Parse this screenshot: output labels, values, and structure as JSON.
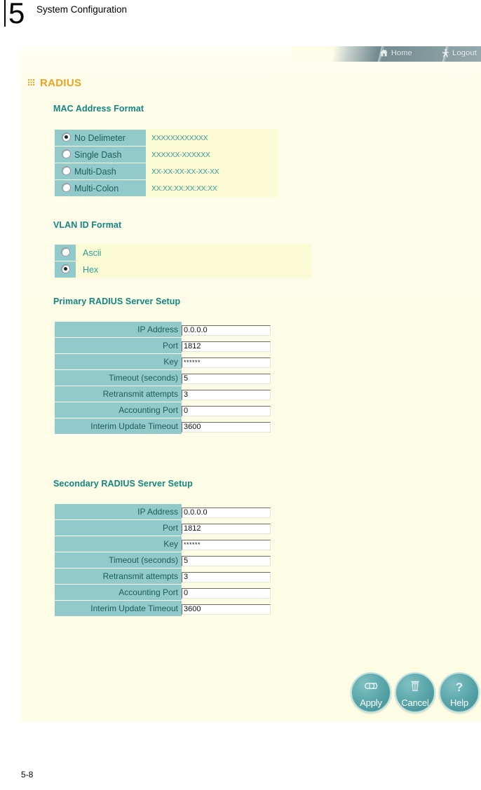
{
  "manual": {
    "chapter_number": "5",
    "chapter_title": "System Configuration",
    "page_footer": "5-8"
  },
  "nav": {
    "home_label": "Home",
    "logout_label": "Logout",
    "home_icon": "home-icon",
    "logout_icon": "logout-running-person-icon"
  },
  "page": {
    "title": "RADIUS",
    "title_icon": "grid-dots-icon",
    "title_color": "#f0a11e",
    "heading_color": "#13877f",
    "label_cell_color": "#92c9cb",
    "panel_color": "#fdfce8",
    "highlight_color": "#fafbd5"
  },
  "mac_format": {
    "heading": "MAC Address Format",
    "options": [
      {
        "label": "No Delimeter",
        "example": "XXXXXXXXXXXX",
        "selected": true
      },
      {
        "label": "Single Dash",
        "example": "XXXXXX-XXXXXX",
        "selected": false
      },
      {
        "label": "Multi-Dash",
        "example": "XX-XX-XX-XX-XX-XX",
        "selected": false
      },
      {
        "label": "Multi-Colon",
        "example": "XX:XX:XX:XX:XX:XX",
        "selected": false
      }
    ]
  },
  "vlan_format": {
    "heading": "VLAN ID Format",
    "options": [
      {
        "label": "Ascii",
        "selected": false
      },
      {
        "label": "Hex",
        "selected": true
      }
    ]
  },
  "primary_server": {
    "heading": "Primary RADIUS Server Setup",
    "fields": [
      {
        "label": "IP Address",
        "value": "0.0.0.0",
        "type": "text"
      },
      {
        "label": "Port",
        "value": "1812",
        "type": "text"
      },
      {
        "label": "Key",
        "value": "******",
        "type": "password"
      },
      {
        "label": "Timeout (seconds)",
        "value": "5",
        "type": "text"
      },
      {
        "label": "Retransmit attempts",
        "value": "3",
        "type": "text"
      },
      {
        "label": "Accounting Port",
        "value": "0",
        "type": "text"
      },
      {
        "label": "Interim Update Timeout",
        "value": "3600",
        "type": "text"
      }
    ]
  },
  "secondary_server": {
    "heading": "Secondary RADIUS Server Setup",
    "fields": [
      {
        "label": "IP Address",
        "value": "0.0.0.0",
        "type": "text"
      },
      {
        "label": "Port",
        "value": "1812",
        "type": "text"
      },
      {
        "label": "Key",
        "value": "******",
        "type": "password"
      },
      {
        "label": "Timeout (seconds)",
        "value": "5",
        "type": "text"
      },
      {
        "label": "Retransmit attempts",
        "value": "3",
        "type": "text"
      },
      {
        "label": "Accounting Port",
        "value": "0",
        "type": "text"
      },
      {
        "label": "Interim Update Timeout",
        "value": "3600",
        "type": "text"
      }
    ]
  },
  "actions": [
    {
      "label": "Apply",
      "icon": "save-disk-icon"
    },
    {
      "label": "Cancel",
      "icon": "trash-can-icon"
    },
    {
      "label": "Help",
      "icon": "question-mark-icon"
    }
  ]
}
